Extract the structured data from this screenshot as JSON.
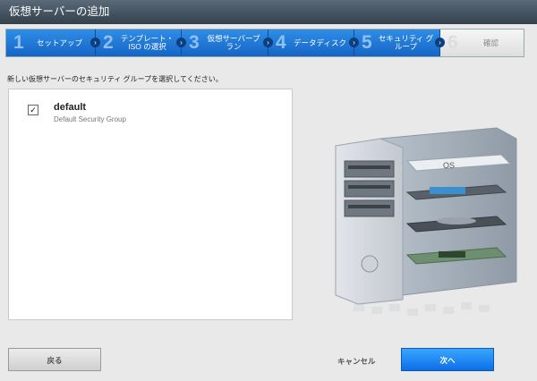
{
  "window": {
    "title": "仮想サーバーの追加"
  },
  "wizard": {
    "steps": [
      {
        "num": "1",
        "label": "セットアップ",
        "active": true
      },
      {
        "num": "2",
        "label": "テンプレート・ ISO の選択",
        "active": true
      },
      {
        "num": "3",
        "label": "仮想サーバープ ラン",
        "active": true
      },
      {
        "num": "4",
        "label": "データディスク",
        "active": true
      },
      {
        "num": "5",
        "label": "セキュリティ グループ",
        "active": true
      },
      {
        "num": "6",
        "label": "確認",
        "active": false
      }
    ],
    "arrow_glyph": "›"
  },
  "main": {
    "instruction": "新しい仮想サーバーのセキュリティ グループを選択してください。",
    "security_groups": [
      {
        "name": "default",
        "description": "Default Security Group",
        "checked": true
      }
    ],
    "check_glyph": "✓"
  },
  "illustration": {
    "disk_label": "OS"
  },
  "footer": {
    "back_label": "戻る",
    "cancel_label": "キャンセル",
    "next_label": "次へ"
  },
  "colors": {
    "accent": "#1a73d4",
    "titlebar": "#3e4c59"
  }
}
